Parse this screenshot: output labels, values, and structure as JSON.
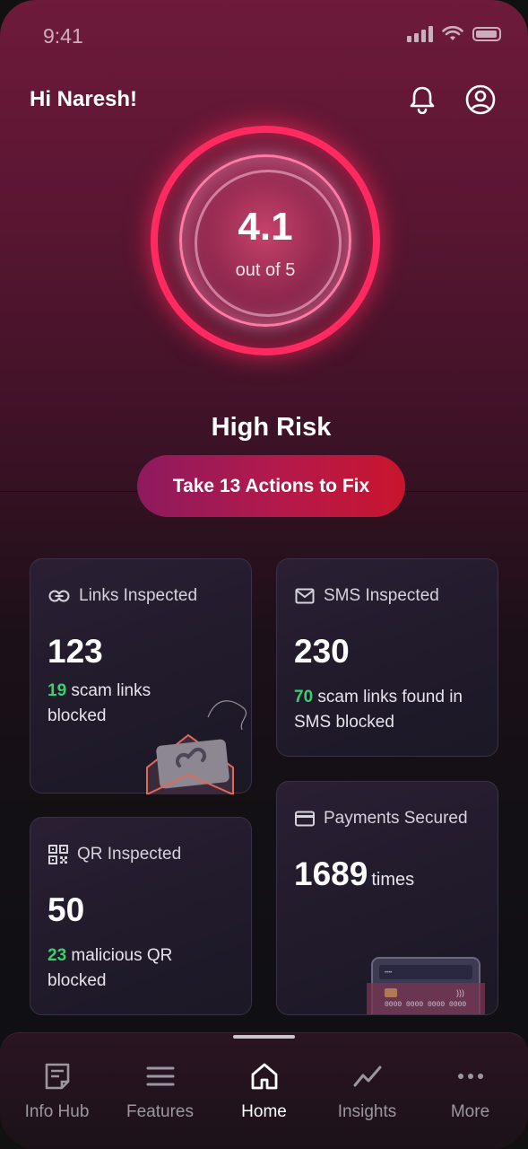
{
  "status_bar": {
    "time": "9:41"
  },
  "header": {
    "greeting": "Hi Naresh!"
  },
  "score": {
    "value": "4.1",
    "subtitle": "out of 5",
    "risk_label": "High Risk",
    "cta_label": "Take 13 Actions to Fix"
  },
  "cards": {
    "links": {
      "title": "Links Inspected",
      "count": "123",
      "highlight": "19",
      "desc_line1": " scam links",
      "desc_line2": "blocked"
    },
    "sms": {
      "title": "SMS Inspected",
      "count": "230",
      "highlight": "70",
      "desc_line1": " scam links found in",
      "desc_line2": "SMS blocked"
    },
    "qr": {
      "title": "QR Inspected",
      "count": "50",
      "highlight": "23",
      "desc_line1": " malicious QR",
      "desc_line2": "blocked"
    },
    "payments": {
      "title": "Payments Secured",
      "count": "1689",
      "suffix": "times",
      "card_number": "0000 0000 0000 0000"
    }
  },
  "nav": {
    "items": [
      {
        "label": "Info Hub",
        "icon": "document-icon"
      },
      {
        "label": "Features",
        "icon": "menu-lines-icon"
      },
      {
        "label": "Home",
        "icon": "home-icon",
        "active": true
      },
      {
        "label": "Insights",
        "icon": "trend-line-icon"
      },
      {
        "label": "More",
        "icon": "more-dots-icon"
      }
    ]
  },
  "colors": {
    "accent": "#ff2a5f",
    "highlight_green": "#3ad06d",
    "cta_start": "#8e1a5e",
    "cta_end": "#c8152e"
  }
}
